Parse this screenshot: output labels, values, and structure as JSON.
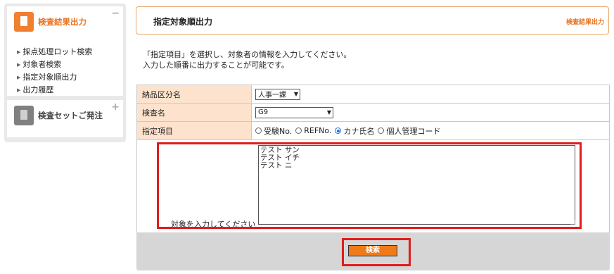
{
  "sidebar": {
    "section1": {
      "title": "検査結果出力",
      "toggle": "−",
      "items": [
        {
          "label": "採点処理ロット検索"
        },
        {
          "label": "対象者検索"
        },
        {
          "label": "指定対象順出力"
        },
        {
          "label": "出力履歴"
        }
      ]
    },
    "section2": {
      "title": "検査セットご発注",
      "toggle": "+"
    },
    "bullet": "▶"
  },
  "header": {
    "title": "指定対象順出力",
    "breadcrumb": "検査結果出力"
  },
  "intro": {
    "line1": "「指定項目」を選択し、対象者の情報を入力してください。",
    "line2": "入力した順番に出力することが可能です。"
  },
  "form": {
    "delivery": {
      "label": "納品区分名",
      "value": "人事一課"
    },
    "exam": {
      "label": "検査名",
      "value": "G9"
    },
    "field": {
      "label": "指定項目",
      "options": [
        {
          "label": "受験No.",
          "selected": false
        },
        {
          "label": "REFNo.",
          "selected": false
        },
        {
          "label": "カナ氏名",
          "selected": true
        },
        {
          "label": "個人管理コード",
          "selected": false
        }
      ]
    },
    "target": {
      "label": "対象を入力してください",
      "value": "テスト サン\nテスト イチ\nテスト ニ"
    }
  },
  "search_button": "検索",
  "colors": {
    "accent": "#e6721f",
    "highlight": "#e01c1c",
    "label_bg": "#fde3cd"
  }
}
